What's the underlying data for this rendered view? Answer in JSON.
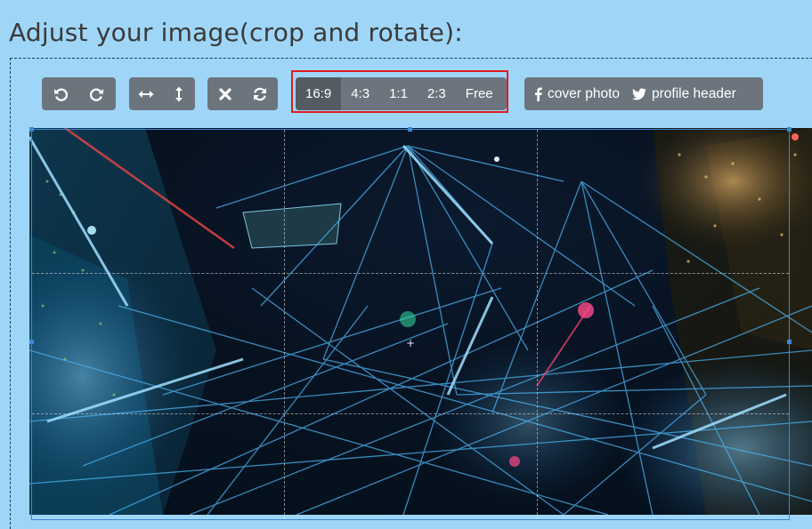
{
  "page": {
    "title": "Adjust your image(crop and rotate):"
  },
  "toolbar": {
    "rotate_group": [
      {
        "name": "rotate-left-icon"
      },
      {
        "name": "rotate-right-icon"
      }
    ],
    "flip_group": [
      {
        "name": "flip-horizontal-icon"
      },
      {
        "name": "flip-vertical-icon"
      }
    ],
    "reset_group": [
      {
        "name": "close-icon"
      },
      {
        "name": "refresh-icon"
      }
    ],
    "ratios": [
      "16:9",
      "4:3",
      "1:1",
      "2:3",
      "Free"
    ],
    "active_ratio": "16:9",
    "social": {
      "cover_label": "cover photo",
      "cover_icon": "facebook-icon",
      "header_label": "profile header",
      "header_icon": "twitter-icon"
    }
  },
  "colors": {
    "background": "#9fd6f8",
    "button": "#6c757d",
    "button_active": "#545b62",
    "highlight": "#e01c1c",
    "crop_border": "#3a87d8"
  }
}
